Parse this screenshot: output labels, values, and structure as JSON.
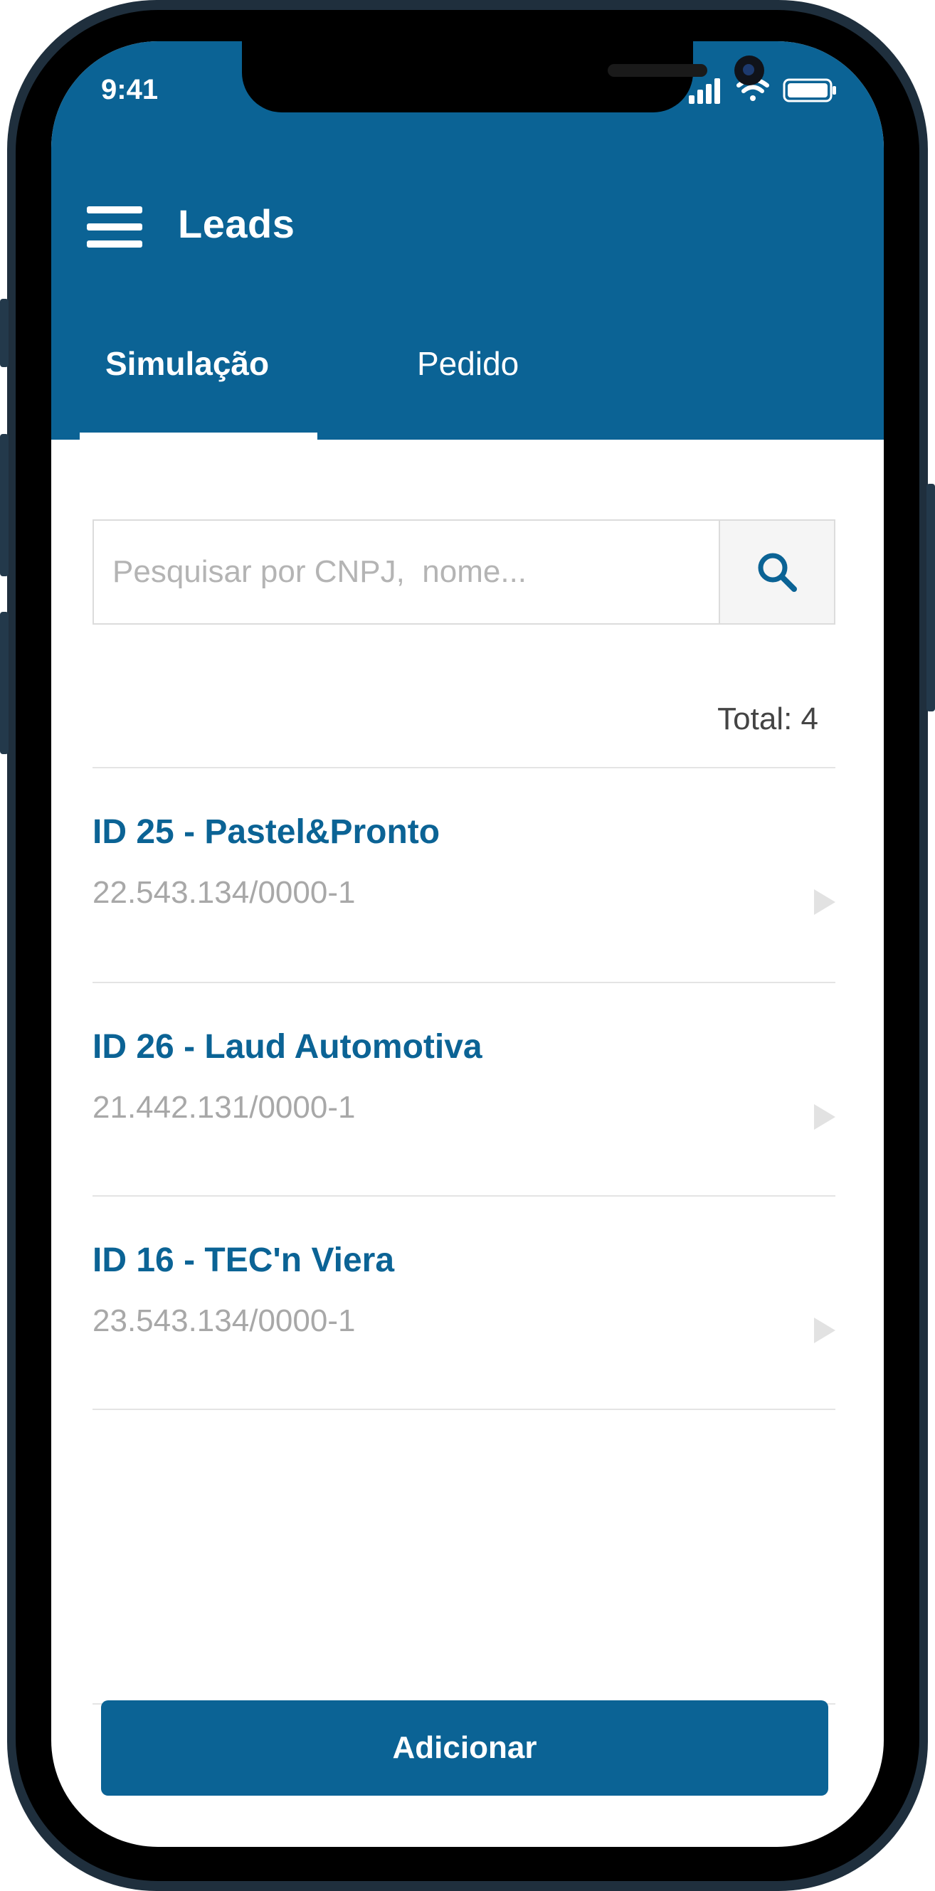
{
  "status_bar": {
    "time": "9:41",
    "icons": [
      "signal-icon",
      "wifi-icon",
      "battery-icon"
    ]
  },
  "header": {
    "title": "Leads",
    "menu_icon": "menu-icon"
  },
  "tabs": [
    {
      "label": "Simulação",
      "active": true
    },
    {
      "label": "Pedido",
      "active": false
    }
  ],
  "search": {
    "placeholder": "Pesquisar por CNPJ,  nome...",
    "value": "",
    "icon": "search-icon"
  },
  "total_label": "Total: 4",
  "leads": [
    {
      "title": "ID 25 - Pastel&Pronto",
      "cnpj": "22.543.134/0000-1"
    },
    {
      "title": "ID 26 - Laud Automotiva",
      "cnpj": "21.442.131/0000-1"
    },
    {
      "title": "ID 16 - TEC'n Viera",
      "cnpj": "23.543.134/0000-1"
    }
  ],
  "add_button_label": "Adicionar",
  "colors": {
    "primary": "#0b6395",
    "secondary_text": "#a8a8a8",
    "divider": "#e4e4e4"
  }
}
